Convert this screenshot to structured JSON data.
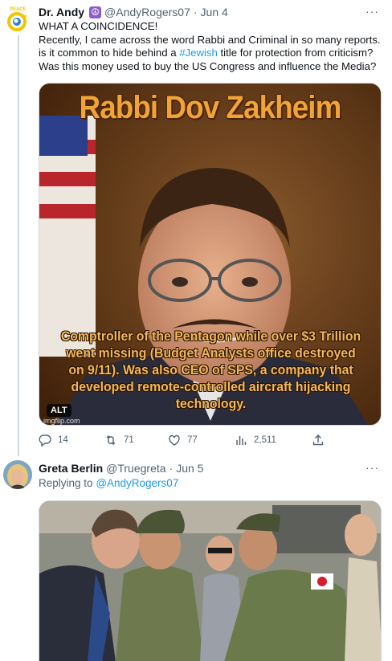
{
  "tweet1": {
    "display_name": "Dr. Andy",
    "badge_icon": "peace-icon",
    "handle": "@AndyRogers07",
    "separator": "·",
    "time": "Jun 4",
    "more": "···",
    "text_line1": "WHAT A COINCIDENCE!",
    "text_part1": "Recently, I came across the word Rabbi and Criminal in so many reports. is it common to hide behind a ",
    "hashtag": "#Jewish",
    "text_part2": " title for protection from criticism? Was this money used to buy the US Congress and influence the Media?",
    "image": {
      "title": "Rabbi Dov Zakheim",
      "caption": "Comptroller of the Pentagon while over $3 Trillion went missing (Budget Analysts office destroyed on 9/11). Was also CEO of SPS, a company that developed remote-controlled aircraft hijacking technology.",
      "alt_badge": "ALT",
      "watermark": "imgflip.com"
    },
    "actions": {
      "replies": "14",
      "retweets": "71",
      "likes": "77",
      "views": "2,511"
    }
  },
  "tweet2": {
    "display_name": "Greta Berlin",
    "handle": "@Truegreta",
    "separator": "·",
    "time": "Jun 5",
    "more": "···",
    "replying_label": "Replying to",
    "replying_handle": "@AndyRogers07"
  },
  "colors": {
    "link": "#1d9bf0",
    "secondary_text": "#536471",
    "primary_text": "#0f1419",
    "meme_text": "#f0a436",
    "thread_line": "#cfd9de"
  }
}
